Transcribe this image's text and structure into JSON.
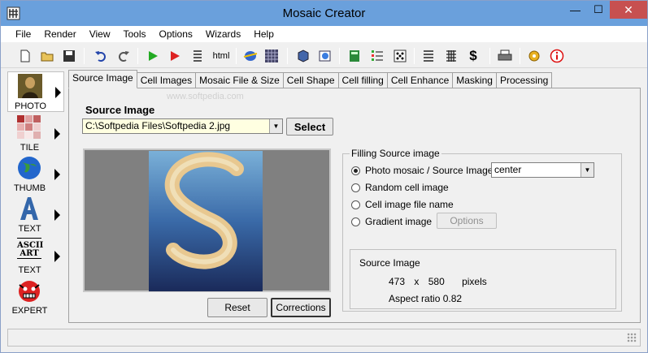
{
  "window": {
    "title": "Mosaic Creator",
    "minimize": "—",
    "maximize": "☐",
    "close": "✕"
  },
  "menu": [
    "File",
    "Render",
    "View",
    "Tools",
    "Options",
    "Wizards",
    "Help"
  ],
  "toolbar": {
    "html_label": "html"
  },
  "sidebar": [
    {
      "label": "PHOTO",
      "icon": "mona-lisa-icon"
    },
    {
      "label": "TILE",
      "icon": "tile-grid-icon"
    },
    {
      "label": "THUMB",
      "icon": "globe-icon"
    },
    {
      "label": "TEXT",
      "icon": "letter-a-icon"
    },
    {
      "label": "TEXT",
      "icon": "ascii-art-icon",
      "icon_text": [
        "ASCII",
        "ART"
      ]
    },
    {
      "label": "EXPERT",
      "icon": "expert-face-icon"
    }
  ],
  "tabs": [
    "Source Image",
    "Cell Images",
    "Mosaic File & Size",
    "Cell Shape",
    "Cell filling",
    "Cell Enhance",
    "Masking",
    "Processing"
  ],
  "source": {
    "heading": "Source Image",
    "path": "C:\\Softpedia Files\\Softpedia 2.jpg",
    "select_label": "Select",
    "reset_label": "Reset",
    "corrections_label": "Corrections",
    "watermark": "www.softpedia.com"
  },
  "filling": {
    "title": "Filling Source image",
    "options": [
      "Photo mosaic / Source Image",
      "Random cell image",
      "Cell image file name",
      "Gradient image"
    ],
    "selected_index": 0,
    "position_value": "center",
    "options_button": "Options"
  },
  "info": {
    "title": "Source Image",
    "width": "473",
    "x": "x",
    "height": "580",
    "unit": "pixels",
    "aspect": "Aspect ratio 0.82"
  }
}
